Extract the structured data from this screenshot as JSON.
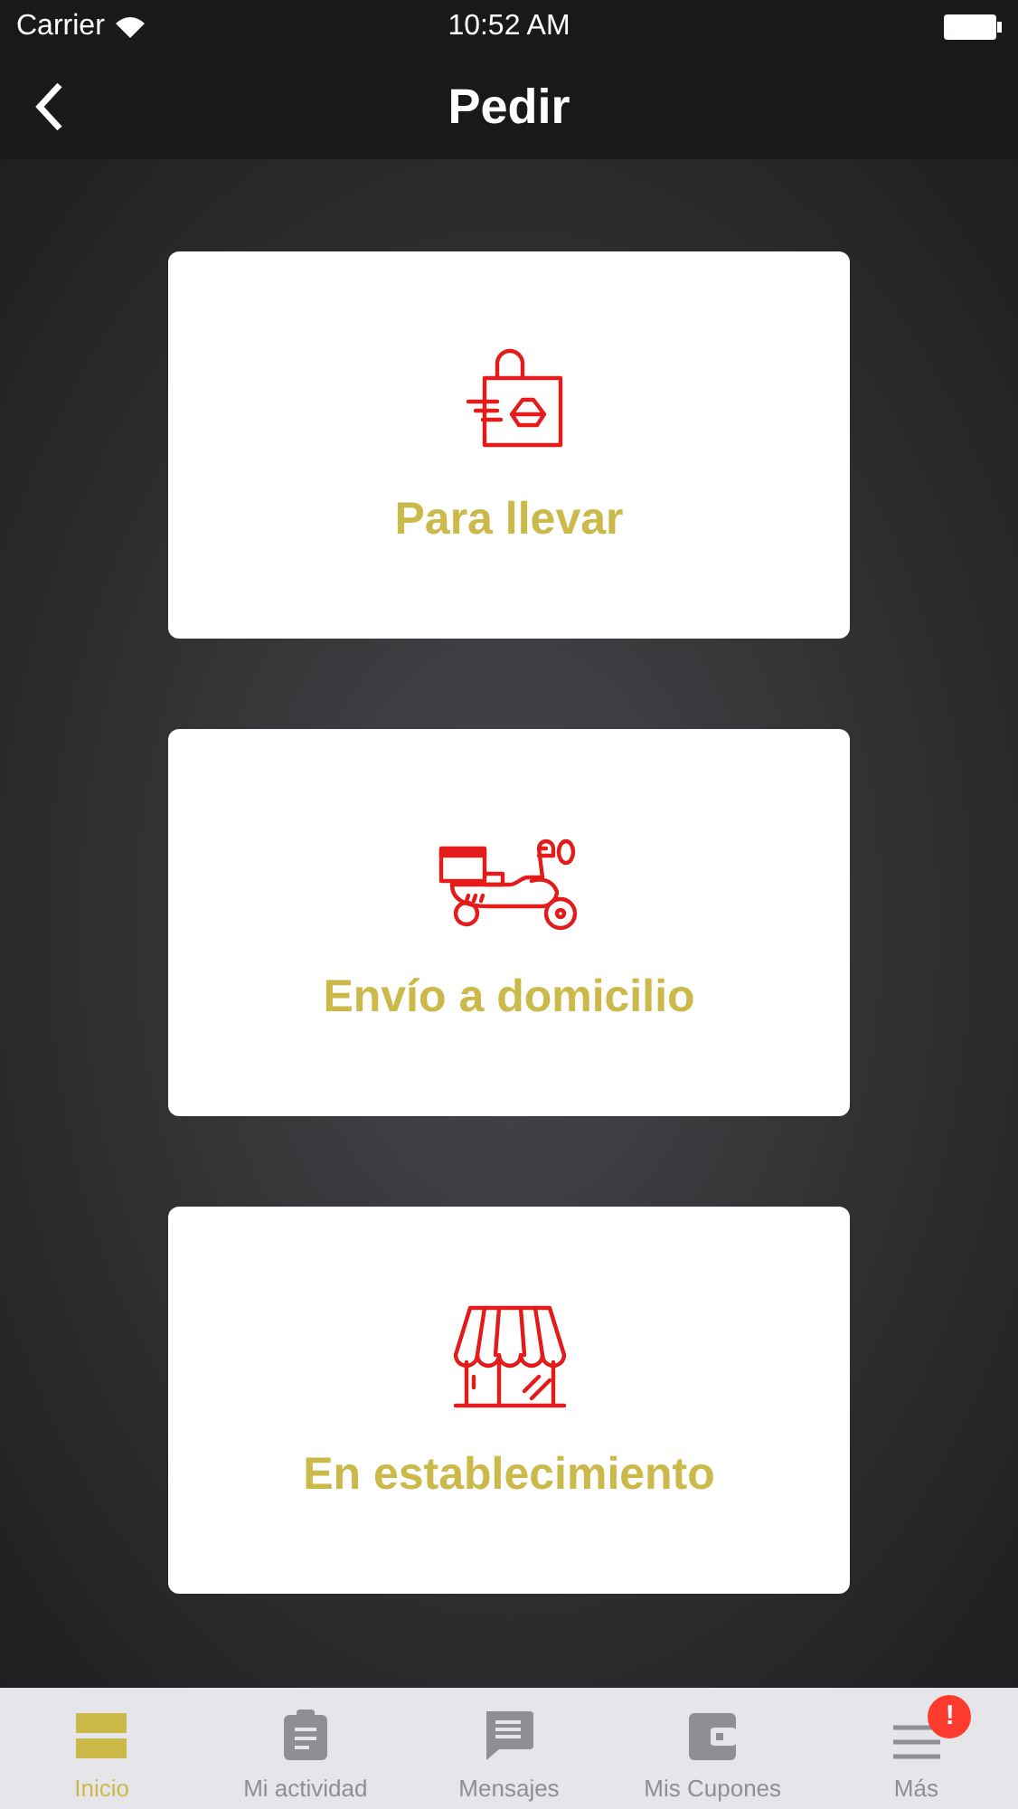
{
  "status_bar": {
    "carrier": "Carrier",
    "time": "10:52 AM"
  },
  "nav": {
    "title": "Pedir"
  },
  "options": [
    {
      "kind": "takeaway",
      "label": "Para llevar"
    },
    {
      "kind": "delivery",
      "label": "Envío a domicilio"
    },
    {
      "kind": "store",
      "label": "En establecimiento"
    }
  ],
  "tabs": [
    {
      "kind": "home",
      "label": "Inicio",
      "selected": true
    },
    {
      "kind": "activity",
      "label": "Mi actividad",
      "selected": false
    },
    {
      "kind": "messages",
      "label": "Mensajes",
      "selected": false
    },
    {
      "kind": "coupons",
      "label": "Mis Cupones",
      "selected": false
    },
    {
      "kind": "more",
      "label": "Más",
      "selected": false,
      "badge": "!"
    }
  ]
}
